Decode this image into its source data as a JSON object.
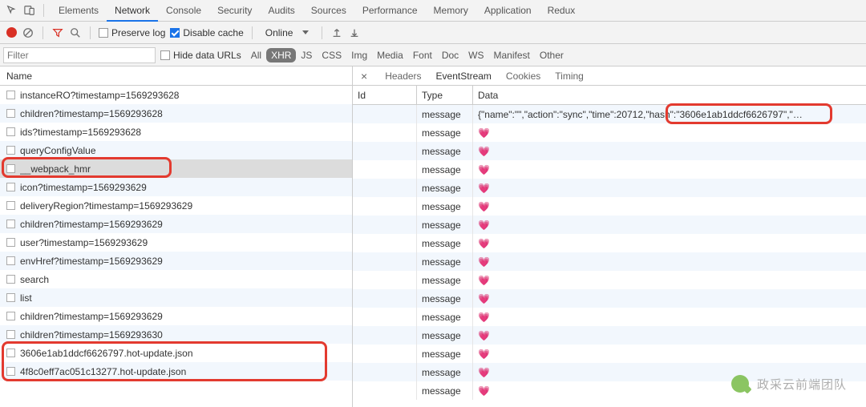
{
  "tabs": {
    "items": [
      "Elements",
      "Network",
      "Console",
      "Security",
      "Audits",
      "Sources",
      "Performance",
      "Memory",
      "Application",
      "Redux"
    ],
    "active": "Network"
  },
  "toolbar": {
    "preserve_log": {
      "label": "Preserve log",
      "checked": false
    },
    "disable_cache": {
      "label": "Disable cache",
      "checked": true
    },
    "throttling": "Online"
  },
  "filter": {
    "placeholder": "Filter",
    "hide_data_urls": {
      "label": "Hide data URLs",
      "checked": false
    },
    "chips": [
      "All",
      "XHR",
      "JS",
      "CSS",
      "Img",
      "Media",
      "Font",
      "Doc",
      "WS",
      "Manifest",
      "Other"
    ],
    "selected": "XHR"
  },
  "left": {
    "header": "Name",
    "rows": [
      {
        "name": "instanceRO?timestamp=1569293628"
      },
      {
        "name": "children?timestamp=1569293628"
      },
      {
        "name": "ids?timestamp=1569293628"
      },
      {
        "name": "queryConfigValue"
      },
      {
        "name": "__webpack_hmr",
        "selected": true
      },
      {
        "name": "icon?timestamp=1569293629"
      },
      {
        "name": "deliveryRegion?timestamp=1569293629"
      },
      {
        "name": "children?timestamp=1569293629"
      },
      {
        "name": "user?timestamp=1569293629"
      },
      {
        "name": "envHref?timestamp=1569293629"
      },
      {
        "name": "search"
      },
      {
        "name": "list"
      },
      {
        "name": "children?timestamp=1569293629"
      },
      {
        "name": "children?timestamp=1569293630"
      },
      {
        "name": "3606e1ab1ddcf6626797.hot-update.json"
      },
      {
        "name": "4f8c0eff7ac051c13277.hot-update.json"
      }
    ]
  },
  "detail_tabs": {
    "items": [
      "Headers",
      "EventStream",
      "Cookies",
      "Timing"
    ],
    "active": "EventStream"
  },
  "stream": {
    "headers": {
      "id": "Id",
      "type": "Type",
      "data": "Data"
    },
    "rows": [
      {
        "id": "",
        "type": "message",
        "data": "{\"name\":\"\",\"action\":\"sync\",\"time\":20712,\"hash\":\"3606e1ab1ddcf6626797\",\"…"
      },
      {
        "id": "",
        "type": "message",
        "data": "💗"
      },
      {
        "id": "",
        "type": "message",
        "data": "💗"
      },
      {
        "id": "",
        "type": "message",
        "data": "💗"
      },
      {
        "id": "",
        "type": "message",
        "data": "💗"
      },
      {
        "id": "",
        "type": "message",
        "data": "💗"
      },
      {
        "id": "",
        "type": "message",
        "data": "💗"
      },
      {
        "id": "",
        "type": "message",
        "data": "💗"
      },
      {
        "id": "",
        "type": "message",
        "data": "💗"
      },
      {
        "id": "",
        "type": "message",
        "data": "💗"
      },
      {
        "id": "",
        "type": "message",
        "data": "💗"
      },
      {
        "id": "",
        "type": "message",
        "data": "💗"
      },
      {
        "id": "",
        "type": "message",
        "data": "💗"
      },
      {
        "id": "",
        "type": "message",
        "data": "💗"
      },
      {
        "id": "",
        "type": "message",
        "data": "💗"
      },
      {
        "id": "",
        "type": "message",
        "data": "💗"
      }
    ]
  },
  "watermark": "政采云前端团队"
}
